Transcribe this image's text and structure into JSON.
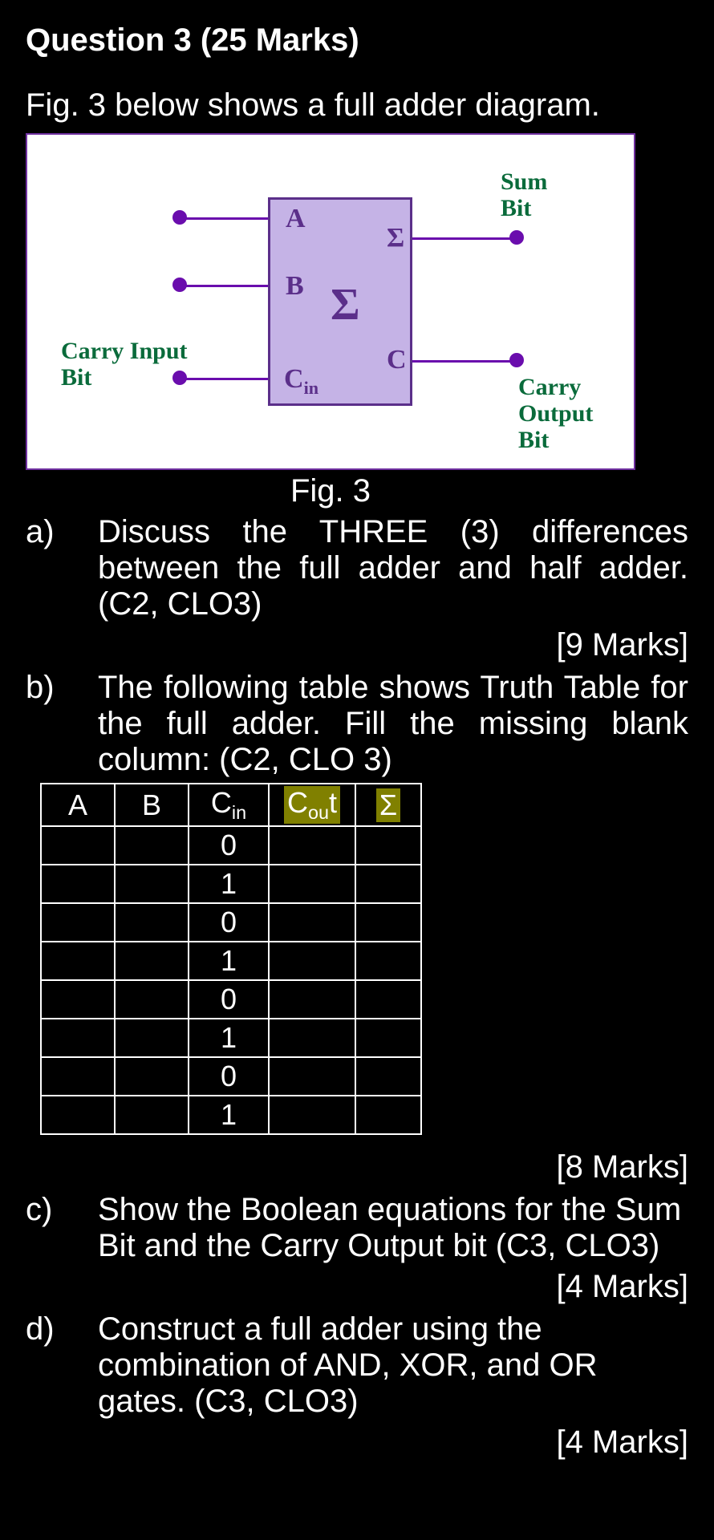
{
  "title": "Question 3 (25 Marks)",
  "intro": "Fig. 3 below shows a full adder diagram.",
  "diagram": {
    "inputA": "A",
    "inputB": "B",
    "inputCin": "C",
    "inputCinSub": "in",
    "sigmaBig": "Σ",
    "outSigma": "Σ",
    "outC": "C",
    "carryInLabel1": "Carry Input",
    "carryInLabel2": "Bit",
    "sumLabel1": "Sum",
    "sumLabel2": "Bit",
    "carryOutLabel1": "Carry",
    "carryOutLabel2": "Output",
    "carryOutLabel3": "Bit"
  },
  "figCaption": "Fig. 3",
  "parts": {
    "a": {
      "letter": "a)",
      "text": "Discuss the THREE (3) differences between the full adder and half adder. (C2, CLO3)",
      "marks": "[9 Marks]"
    },
    "b": {
      "letter": "b)",
      "text": "The following table shows Truth Table for the full adder. Fill the missing blank column: (C2, CLO 3)",
      "marks": "[8 Marks]"
    },
    "c": {
      "letter": "c)",
      "text": "Show the Boolean equations for the Sum Bit and the Carry Output bit (C3, CLO3)",
      "marks": "[4 Marks]"
    },
    "d": {
      "letter": "d)",
      "text": "Construct a full adder using the combination of AND, XOR, and OR gates. (C3, CLO3)",
      "marks": "[4 Marks]"
    }
  },
  "truthTable": {
    "headers": {
      "A": "A",
      "B": "B",
      "Cin": "C",
      "CinSub": "in",
      "Cout": "C",
      "CoutSub": "ou",
      "CoutT": "t",
      "Sigma": "Σ"
    },
    "rows": [
      {
        "A": "",
        "B": "",
        "Cin": "0",
        "Cout": "",
        "Sigma": ""
      },
      {
        "A": "",
        "B": "",
        "Cin": "1",
        "Cout": "",
        "Sigma": ""
      },
      {
        "A": "",
        "B": "",
        "Cin": "0",
        "Cout": "",
        "Sigma": ""
      },
      {
        "A": "",
        "B": "",
        "Cin": "1",
        "Cout": "",
        "Sigma": ""
      },
      {
        "A": "",
        "B": "",
        "Cin": "0",
        "Cout": "",
        "Sigma": ""
      },
      {
        "A": "",
        "B": "",
        "Cin": "1",
        "Cout": "",
        "Sigma": ""
      },
      {
        "A": "",
        "B": "",
        "Cin": "0",
        "Cout": "",
        "Sigma": ""
      },
      {
        "A": "",
        "B": "",
        "Cin": "1",
        "Cout": "",
        "Sigma": ""
      }
    ]
  }
}
